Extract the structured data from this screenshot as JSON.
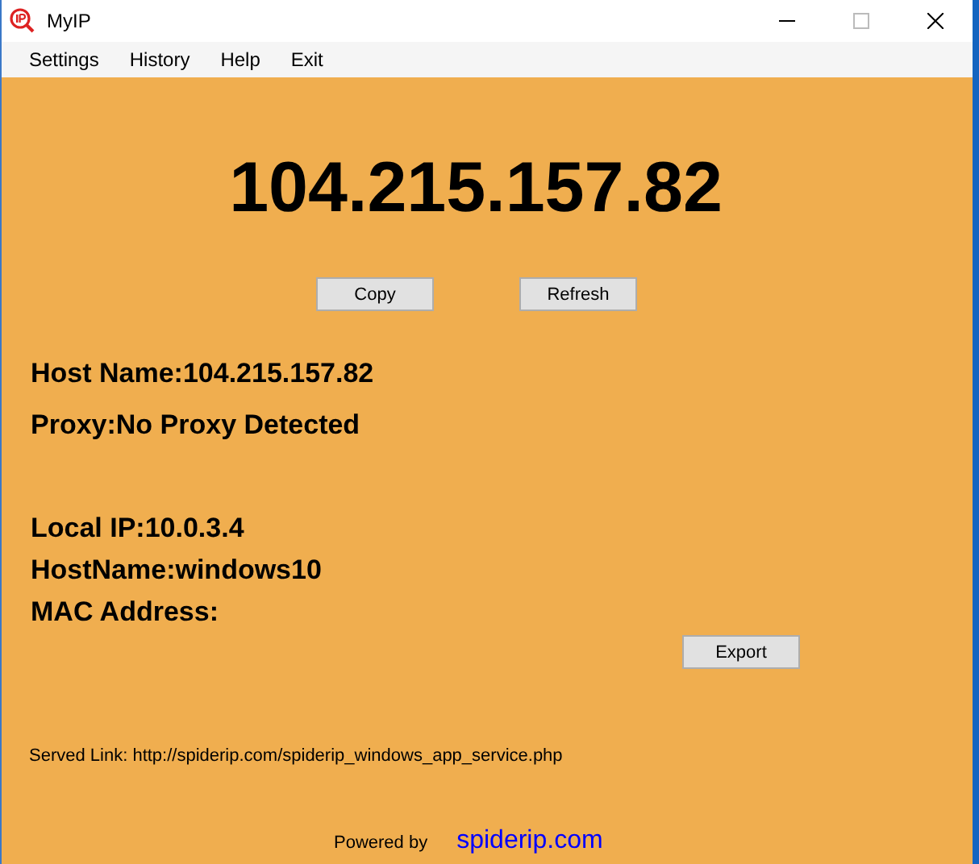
{
  "window": {
    "title": "MyIP"
  },
  "menu": [
    "Settings",
    "History",
    "Help",
    "Exit"
  ],
  "public_ip": "104.215.157.82",
  "buttons": [
    "Copy",
    "Refresh"
  ],
  "network_info": [
    "Host Name:104.215.157.82",
    "Proxy:No Proxy Detected"
  ],
  "local_info": [
    "Local IP:10.0.3.4",
    "HostName:windows10",
    "MAC Address:"
  ],
  "export_button": "Export",
  "served_link": "Served Link: http://spiderip.com/spiderip_windows_app_service.php",
  "powered_by": "Powered by",
  "site_link": "spiderip.com"
}
